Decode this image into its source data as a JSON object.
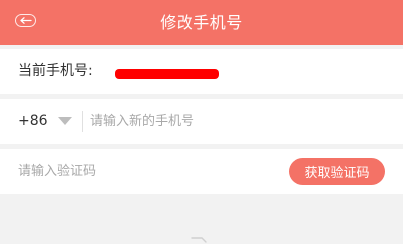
{
  "header": {
    "title": "修改手机号",
    "back_icon": "back-icon"
  },
  "current_phone": {
    "label": "当前手机号:"
  },
  "new_phone": {
    "country_code": "+86",
    "placeholder": "请输入新的手机号"
  },
  "verification": {
    "placeholder": "请输入验证码",
    "button_label": "获取验证码"
  },
  "colors": {
    "accent": "#f47266",
    "background": "#f2f2f2",
    "redaction": "#ff0000"
  }
}
